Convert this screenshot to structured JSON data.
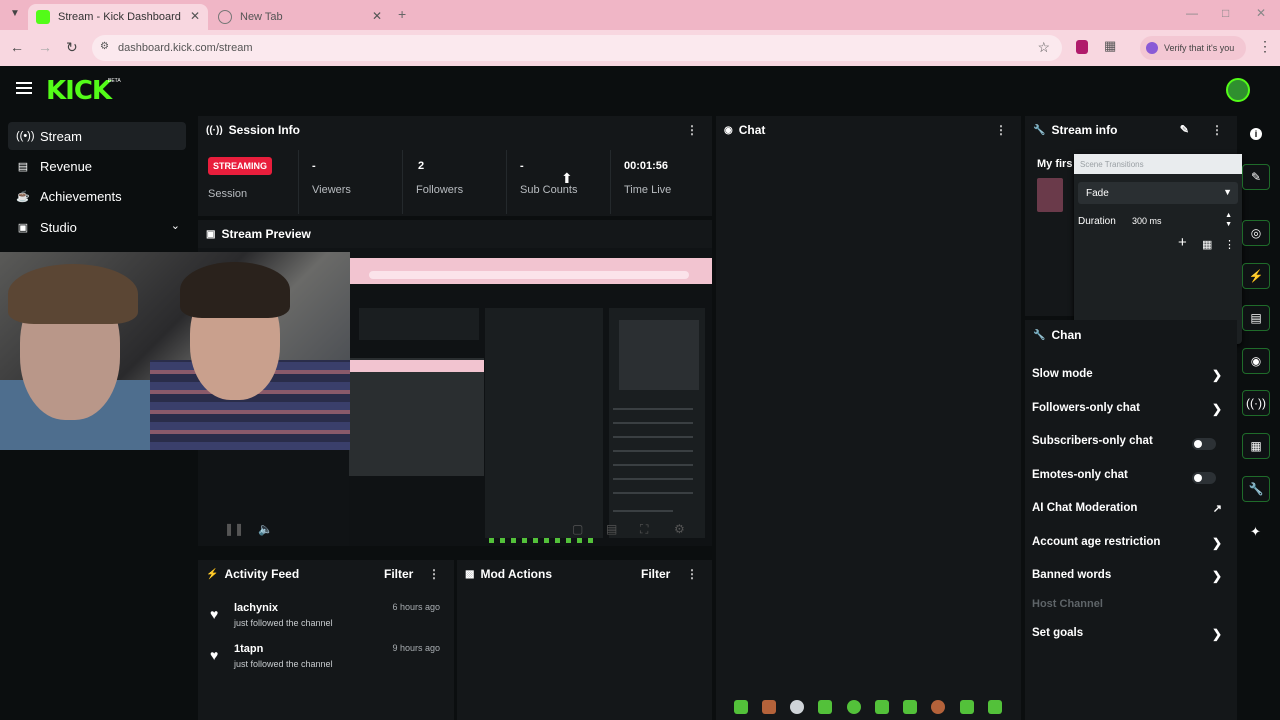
{
  "browser": {
    "tabs": [
      {
        "title": "Stream - Kick Dashboard",
        "active": true
      },
      {
        "title": "New Tab",
        "active": false
      }
    ],
    "url": "dashboard.kick.com/stream",
    "verify_text": "Verify that it's you"
  },
  "app": {
    "logo": "KICK",
    "beta": "BETA"
  },
  "sidebar": {
    "items": [
      {
        "label": "Stream",
        "icon": "broadcast-icon"
      },
      {
        "label": "Revenue",
        "icon": "chart-icon"
      },
      {
        "label": "Achievements",
        "icon": "trophy-icon"
      },
      {
        "label": "Studio",
        "icon": "video-icon"
      }
    ]
  },
  "session": {
    "title": "Session Info",
    "status_badge": "STREAMING",
    "session_label": "Session",
    "stats": [
      {
        "value": "-",
        "label": "Viewers"
      },
      {
        "value": "2",
        "label": "Followers"
      },
      {
        "value": "-",
        "label": "Sub Counts"
      },
      {
        "value": "00:01:56",
        "label": "Time Live"
      }
    ]
  },
  "preview": {
    "title": "Stream Preview"
  },
  "chat": {
    "title": "Chat"
  },
  "stream_info": {
    "title": "Stream info",
    "stream_title_partial": "My firs",
    "popup": {
      "header": "Scene Transitions",
      "transition": "Fade",
      "duration_label": "Duration",
      "duration_value": "300 ms"
    }
  },
  "chat_settings": {
    "title_partial": "Chan",
    "rows": [
      {
        "label": "Slow mode",
        "control": "arrow"
      },
      {
        "label": "Followers-only chat",
        "control": "arrow"
      },
      {
        "label": "Subscribers-only chat",
        "control": "toggle"
      },
      {
        "label": "Emotes-only chat",
        "control": "toggle"
      },
      {
        "label": "AI Chat Moderation",
        "control": "external"
      },
      {
        "label": "Account age restriction",
        "control": "arrow"
      },
      {
        "label": "Banned words",
        "control": "arrow"
      }
    ],
    "host_channel": "Host Channel",
    "set_goals": "Set goals"
  },
  "activity_feed": {
    "title": "Activity Feed",
    "filter": "Filter",
    "items": [
      {
        "name": "lachynix",
        "action": "just followed the channel",
        "time": "6 hours ago"
      },
      {
        "name": "1tapn",
        "action": "just followed the channel",
        "time": "9 hours ago"
      }
    ]
  },
  "mod_actions": {
    "title": "Mod Actions",
    "filter": "Filter"
  },
  "colors": {
    "accent": "#53fc18",
    "streaming": "#e91e3c",
    "panel": "#141719",
    "background": "#0b0e0f"
  }
}
